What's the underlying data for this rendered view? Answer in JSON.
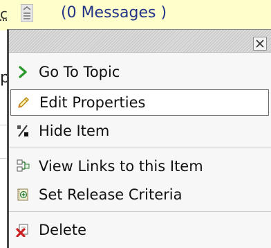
{
  "background": {
    "top_left_text": "c",
    "messages_text": "(0 Messages )",
    "under_text": "p",
    "colors": {
      "highlight_bar": "#ffffcc",
      "messages_text": "#223388"
    }
  },
  "popup_menu": {
    "close_icon": "close-icon",
    "items": [
      {
        "label": "Go To Topic",
        "icon": "chevron-right-icon",
        "state": "normal"
      },
      {
        "label": "Edit Properties",
        "icon": "pencil-icon",
        "state": "highlighted"
      },
      {
        "label": "Hide Item",
        "icon": "percent-hide-icon",
        "state": "normal"
      },
      {
        "label": "View Links to this Item",
        "icon": "links-icon",
        "state": "normal"
      },
      {
        "label": "Set Release Criteria",
        "icon": "release-criteria-icon",
        "state": "normal"
      },
      {
        "label": "Delete",
        "icon": "delete-icon",
        "state": "normal"
      }
    ]
  }
}
